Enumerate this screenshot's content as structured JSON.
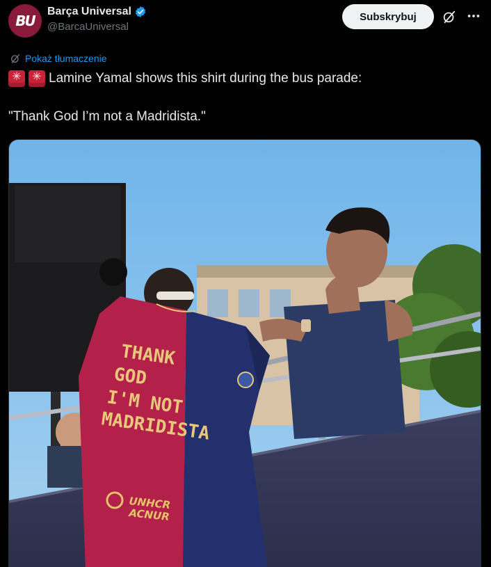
{
  "header": {
    "avatar_text": "BU",
    "display_name": "Barça Universal",
    "handle": "@BarcaUniversal",
    "subscribe_label": "Subskrybuj",
    "icons": [
      "verified-badge-icon",
      "grok-icon",
      "more-icon"
    ]
  },
  "translate": {
    "label": "Pokaż tłumaczenie"
  },
  "tweet": {
    "emoji": [
      "rotating-light",
      "rotating-light"
    ],
    "line1": "Lamine Yamal shows this shirt during the bus parade:",
    "line2": "\"Thank God I’m not a Madridista.\""
  },
  "media": {
    "shirt_lines": [
      "THANK",
      "GOD",
      "I'M NOT",
      "MADRIDISTA"
    ],
    "sponsor": [
      "UNHCR",
      "ACNUR"
    ]
  },
  "colors": {
    "background": "#000000",
    "text": "#e7e9ea",
    "muted": "#71767b",
    "link": "#1d9bf0",
    "avatar": "#8a1a3c",
    "verified": "#1d9bf0",
    "shirt_blaugrana_red": "#b3214a",
    "shirt_blaugrana_blue": "#24306e"
  }
}
